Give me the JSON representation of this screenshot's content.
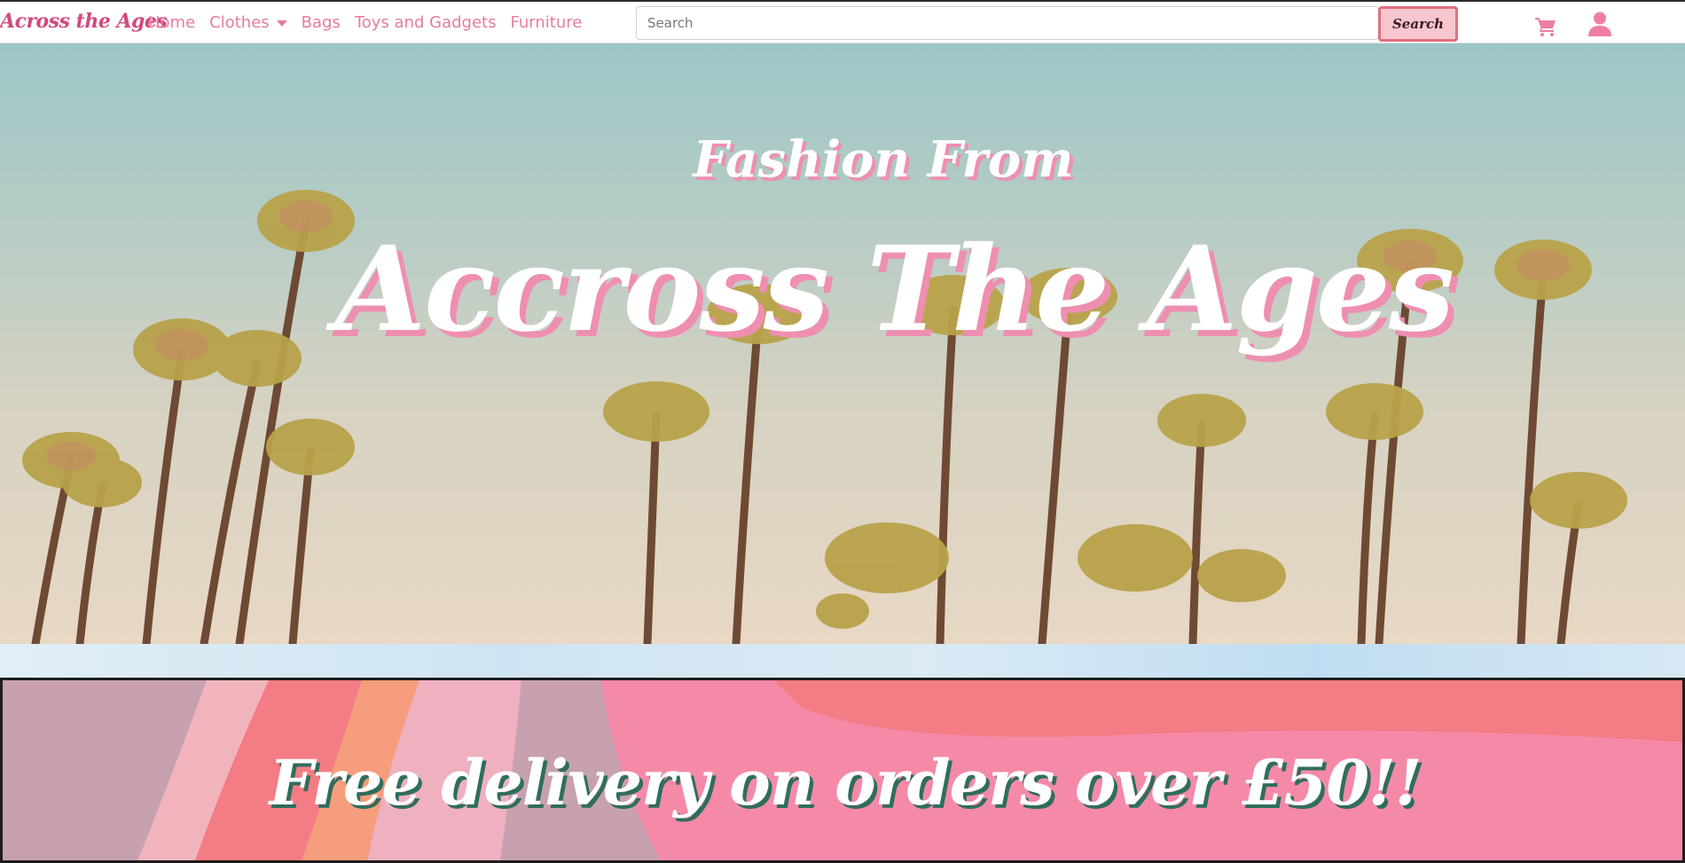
{
  "navbar": {
    "brand": "Across the Ages",
    "links": {
      "home": "Home",
      "clothes": "Clothes",
      "bags": "Bags",
      "toys": "Toys and Gadgets",
      "furniture": "Furniture"
    },
    "search": {
      "placeholder": "Search",
      "button_label": "Search"
    },
    "icons": [
      "cart-icon",
      "user-icon",
      "chevron-down-icon"
    ]
  },
  "hero": {
    "subtitle": "Fashion From",
    "title": "Accross The Ages"
  },
  "banner": {
    "text": "Free delivery on orders over £50!!"
  },
  "colors": {
    "brand_pink": "#d04a7c",
    "link_pink": "#e87aa0",
    "search_button_bg": "#f8c6cf",
    "search_button_border": "#e06f7f",
    "hero_text_shadow": "#ee8fb1",
    "banner_text_shadow": "#2f6d5c"
  }
}
